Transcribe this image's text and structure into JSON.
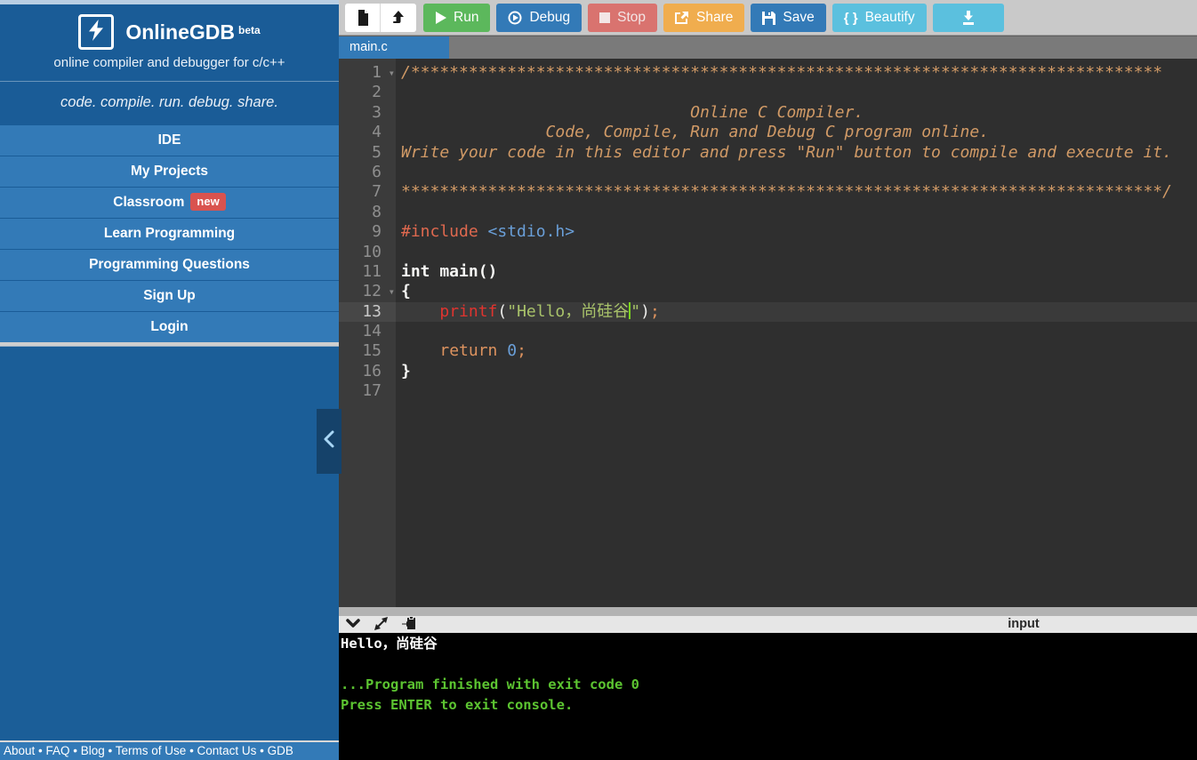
{
  "sidebar": {
    "logo_title": "OnlineGDB",
    "logo_beta": "beta",
    "logo_subtitle": "online compiler and debugger for c/c++",
    "tagline": "code. compile. run. debug. share.",
    "menu": [
      {
        "label": "IDE"
      },
      {
        "label": "My Projects"
      },
      {
        "label": "Classroom",
        "badge": "new"
      },
      {
        "label": "Learn Programming"
      },
      {
        "label": "Programming Questions"
      },
      {
        "label": "Sign Up"
      },
      {
        "label": "Login"
      }
    ],
    "footer_links": [
      "About",
      "FAQ",
      "Blog",
      "Terms of Use",
      "Contact Us",
      "GDB"
    ],
    "footer_separator": "•"
  },
  "toolbar": {
    "run_label": "Run",
    "debug_label": "Debug",
    "stop_label": "Stop",
    "share_label": "Share",
    "save_label": "Save",
    "beautify_braces": "{ }",
    "beautify_label": "Beautify"
  },
  "tabs": [
    {
      "name": "main.c"
    }
  ],
  "editor": {
    "lines": [
      {
        "n": 1,
        "fold": true,
        "tokens": [
          {
            "c": "comment",
            "t": "/******************************************************************************"
          }
        ]
      },
      {
        "n": 2,
        "tokens": []
      },
      {
        "n": 3,
        "tokens": [
          {
            "c": "comment",
            "t": "                              Online C Compiler."
          }
        ]
      },
      {
        "n": 4,
        "tokens": [
          {
            "c": "comment",
            "t": "               Code, Compile, Run and Debug C program online."
          }
        ]
      },
      {
        "n": 5,
        "tokens": [
          {
            "c": "comment",
            "t": "Write your code in this editor and press \"Run\" button to compile and execute it."
          }
        ]
      },
      {
        "n": 6,
        "tokens": []
      },
      {
        "n": 7,
        "tokens": [
          {
            "c": "comment",
            "t": "*******************************************************************************/"
          }
        ]
      },
      {
        "n": 8,
        "tokens": []
      },
      {
        "n": 9,
        "tokens": [
          {
            "c": "preproc",
            "t": "#include"
          },
          {
            "c": "plain",
            "t": " "
          },
          {
            "c": "header",
            "t": "<stdio.h>"
          }
        ]
      },
      {
        "n": 10,
        "tokens": []
      },
      {
        "n": 11,
        "tokens": [
          {
            "c": "plainbold",
            "t": "int main()"
          }
        ]
      },
      {
        "n": 12,
        "fold": true,
        "tokens": [
          {
            "c": "plainbold",
            "t": "{"
          }
        ]
      },
      {
        "n": 13,
        "active": true,
        "tokens": [
          {
            "c": "plain",
            "t": "    "
          },
          {
            "c": "func",
            "t": "printf"
          },
          {
            "c": "plain",
            "t": "("
          },
          {
            "c": "string",
            "t": "\"Hello，尚硅谷"
          },
          {
            "c": "cursor",
            "t": ""
          },
          {
            "c": "string",
            "t": "\""
          },
          {
            "c": "plain",
            "t": ")"
          },
          {
            "c": "semi",
            "t": ";"
          }
        ]
      },
      {
        "n": 14,
        "tokens": []
      },
      {
        "n": 15,
        "tokens": [
          {
            "c": "plain",
            "t": "    "
          },
          {
            "c": "keyword",
            "t": "return"
          },
          {
            "c": "plain",
            "t": " "
          },
          {
            "c": "number",
            "t": "0"
          },
          {
            "c": "semi",
            "t": ";"
          }
        ]
      },
      {
        "n": 16,
        "tokens": [
          {
            "c": "plainbold",
            "t": "}"
          }
        ]
      },
      {
        "n": 17,
        "tokens": []
      }
    ]
  },
  "console": {
    "input_label": "input",
    "output": [
      {
        "text": "Hello，尚硅谷",
        "color": "white"
      },
      {
        "text": "",
        "color": "white"
      },
      {
        "text": "...Program finished with exit code 0",
        "color": "green"
      },
      {
        "text": "Press ENTER to exit console.",
        "color": "green"
      }
    ]
  },
  "colors": {
    "sidebar_blue": "#1b5e98",
    "menu_blue": "#337ab7",
    "badge_red": "#d9534f",
    "run_green": "#5cb85c",
    "debug_blue": "#337ab7",
    "stop_red": "#d9736f",
    "share_orange": "#f0ad4e",
    "beautify_cyan": "#5bc0de",
    "console_green": "#5cc431",
    "editor_bg": "#2f2f2f",
    "gutter_bg": "#3b3b3b"
  }
}
